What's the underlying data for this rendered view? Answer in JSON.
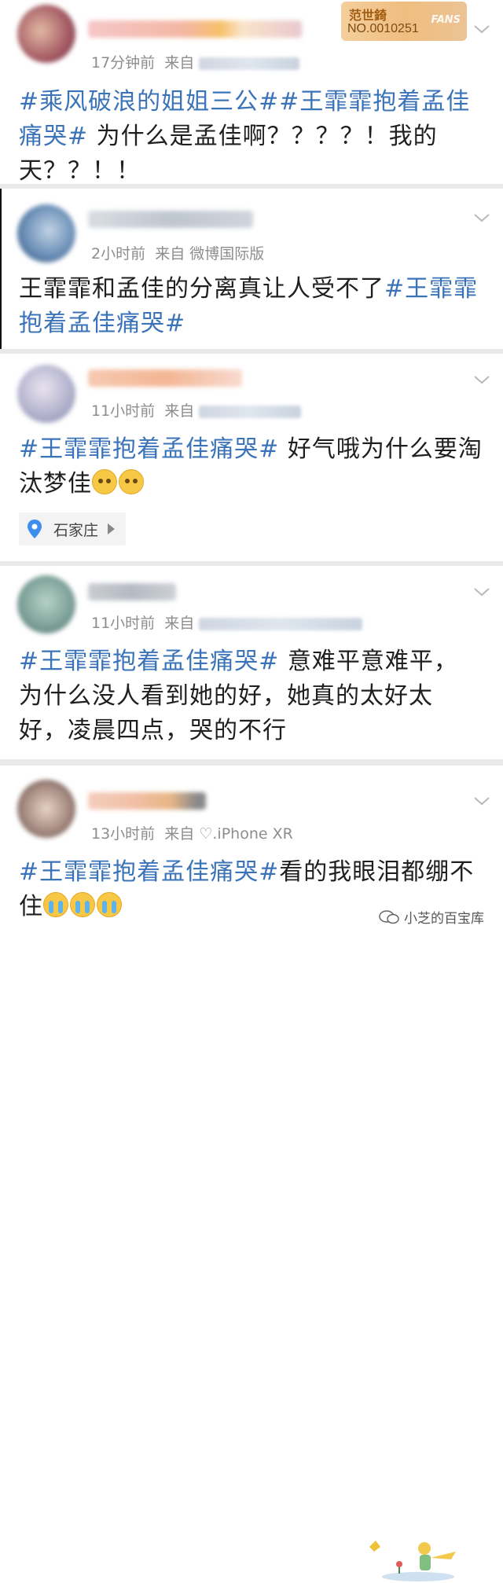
{
  "badge": {
    "top": "范世錡",
    "number": "NO.0010251",
    "fans": "FANS"
  },
  "posts": [
    {
      "time": "17分钟前",
      "from": "来自",
      "source": "",
      "hashtags": [
        "#乘风破浪的姐姐三公#",
        "#王霏霏抱着孟佳痛哭#"
      ],
      "body": " 为什么是孟佳啊？？？？！我的天？？！！"
    },
    {
      "time": "2小时前",
      "from": "来自",
      "source": "微博国际版",
      "body": "王霏霏和孟佳的分离真让人受不了",
      "hashtag": "#王霏霏抱着孟佳痛哭#"
    },
    {
      "time": "11小时前",
      "from": "来自",
      "source": "",
      "hashtag": "#王霏霏抱着孟佳痛哭#",
      "body": " 好气哦为什么要淘汰梦佳",
      "location": "石家庄"
    },
    {
      "time": "11小时前",
      "from": "来自",
      "source": "",
      "hashtag": "#王霏霏抱着孟佳痛哭#",
      "body": " 意难平意难平，为什么没人看到她的好，她真的太好太好，凌晨四点，哭的不行"
    },
    {
      "time": "13小时前",
      "from": "来自",
      "source": "♡.iPhone XR",
      "hashtag": "#王霏霏抱着孟佳痛哭#",
      "body": "看的我眼泪都绷不住"
    }
  ],
  "watermark": "小芝的百宝库",
  "colors": {
    "hashtag": "#3b73b9",
    "meta": "#8d8d8d",
    "separator": "#e9e9e9"
  }
}
